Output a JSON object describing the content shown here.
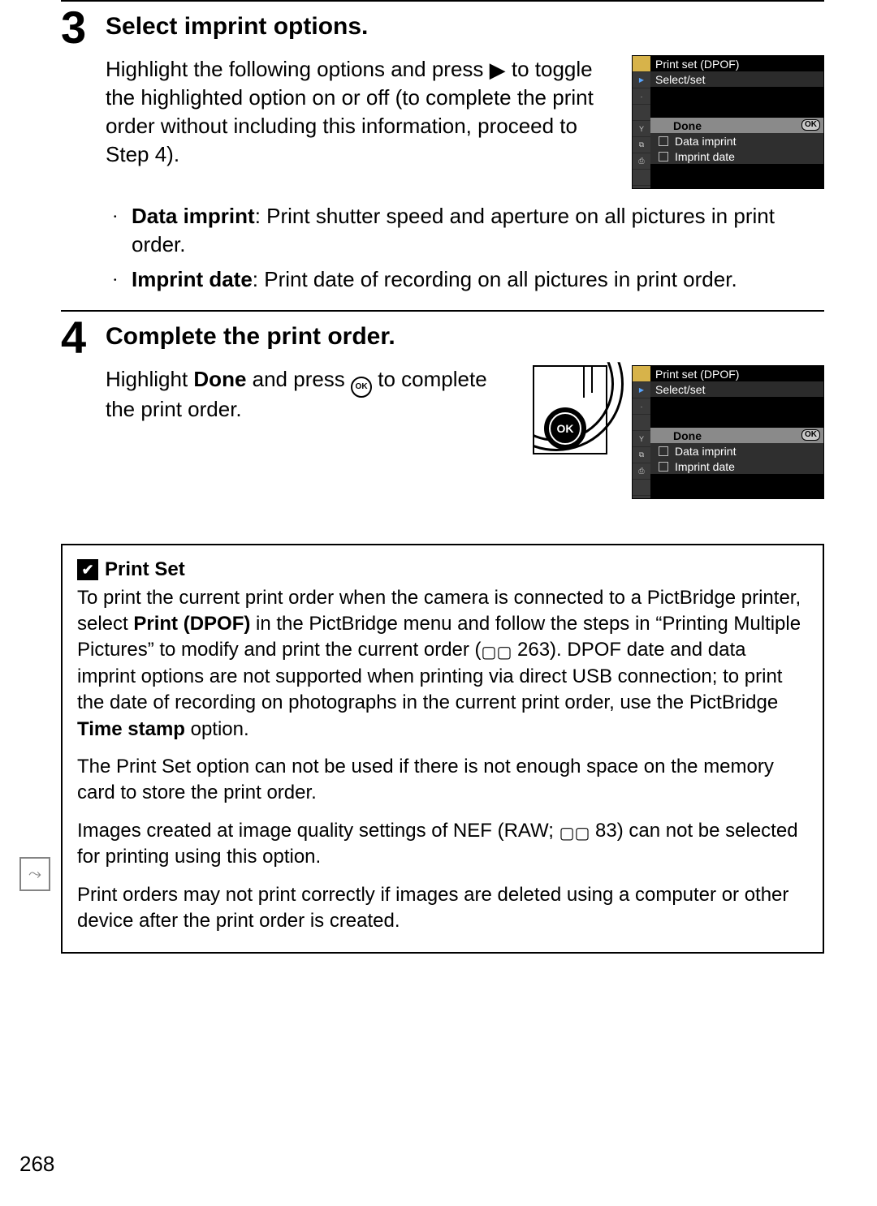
{
  "page_number": "268",
  "step3": {
    "num": "3",
    "title": "Select imprint options.",
    "para_a": "Highlight the following options and press ",
    "para_b": " to toggle the highlighted option on or off (to complete the print order without including this information, proceed to Step 4).",
    "bullet1_head": "Data imprint",
    "bullet1_tail": ": Print shutter speed and aperture on all pictures in print order.",
    "bullet2_head": "Imprint date",
    "bullet2_tail": ": Print date of recording on all pictures in print order."
  },
  "step4": {
    "num": "4",
    "title": "Complete the print order.",
    "para_a": "Highlight ",
    "para_b": "Done",
    "para_c": " and press ",
    "para_d": " to complete the print order.",
    "ok_label": "OK"
  },
  "lcd": {
    "title": "Print set (DPOF)",
    "subtitle": "Select/set",
    "done": "Done",
    "ok": "OK",
    "opt1": "Data imprint",
    "opt2": "Imprint date"
  },
  "note": {
    "icon": "✔",
    "title": "Print Set",
    "p1_a": "To print the current print order when the camera is connected to a PictBridge printer, select ",
    "p1_b": "Print (DPOF)",
    "p1_c": " in the PictBridge menu and follow the steps in “Printing Multiple Pictures” to modify and print the current order (",
    "p1_ref": " 263).  DPOF date and data imprint options are not supported when printing via direct USB connection; to print the date of recording on photographs in the current print order, use the PictBridge ",
    "p1_d": "Time stamp",
    "p1_e": " option.",
    "p2": "The Print Set option can not be used if there is not enough space on the memory card to store the print order.",
    "p3_a": "Images created at image quality settings of NEF (RAW; ",
    "p3_ref": " 83) can not be selected for printing using this option.",
    "p4": "Print orders may not print correctly if images are deleted using a computer or other device after the print order is created."
  },
  "side_tab": "⤳"
}
